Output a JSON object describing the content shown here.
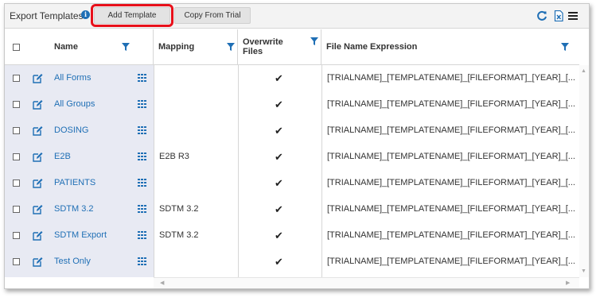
{
  "toolbar": {
    "title": "Export Templates",
    "info_glyph": "i",
    "add_template_label": "Add Template",
    "copy_from_trial_label": "Copy From Trial",
    "icons": [
      "refresh-icon",
      "excel-export-icon",
      "hamburger-menu-icon"
    ]
  },
  "columns": {
    "name": "Name",
    "mapping": "Mapping",
    "overwrite": "Overwrite Files",
    "expression": "File Name Expression"
  },
  "rows": [
    {
      "name": "All Forms",
      "mapping": "",
      "overwrite": "✔",
      "expression": "[TRIALNAME]_[TEMPLATENAME]_[FILEFORMAT]_[YEAR]_[..."
    },
    {
      "name": "All Groups",
      "mapping": "",
      "overwrite": "✔",
      "expression": "[TRIALNAME]_[TEMPLATENAME]_[FILEFORMAT]_[YEAR]_[..."
    },
    {
      "name": "DOSING",
      "mapping": "",
      "overwrite": "✔",
      "expression": "[TRIALNAME]_[TEMPLATENAME]_[FILEFORMAT]_[YEAR]_[..."
    },
    {
      "name": "E2B",
      "mapping": "E2B R3",
      "overwrite": "✔",
      "expression": "[TRIALNAME]_[TEMPLATENAME]_[FILEFORMAT]_[YEAR]_[..."
    },
    {
      "name": "PATIENTS",
      "mapping": "",
      "overwrite": "✔",
      "expression": "[TRIALNAME]_[TEMPLATENAME]_[FILEFORMAT]_[YEAR]_[..."
    },
    {
      "name": "SDTM 3.2",
      "mapping": "SDTM 3.2",
      "overwrite": "✔",
      "expression": "[TRIALNAME]_[TEMPLATENAME]_[FILEFORMAT]_[YEAR]_[..."
    },
    {
      "name": "SDTM Export",
      "mapping": "SDTM 3.2",
      "overwrite": "✔",
      "expression": "[TRIALNAME]_[TEMPLATENAME]_[FILEFORMAT]_[YEAR]_[..."
    },
    {
      "name": "Test Only",
      "mapping": "",
      "overwrite": "✔",
      "expression": "[TRIALNAME]_[TEMPLATENAME]_[FILEFORMAT]_[YEAR]_[..."
    }
  ],
  "colors": {
    "accent": "#1f6fb5",
    "highlight_box": "#e8101a",
    "frozen_column_bg": "#e8eaf3",
    "toolbar_bg": "#f3f3f3"
  }
}
